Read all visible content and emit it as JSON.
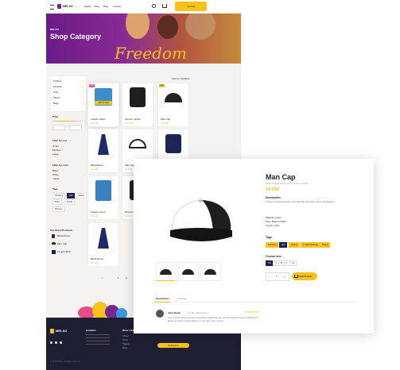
{
  "nav": {
    "logo_text": "MELAO",
    "items": [
      "Home",
      "Pages",
      "Shop",
      "Blog",
      "Contact"
    ],
    "button_label": "Contact"
  },
  "hero": {
    "brand": "MELAO",
    "title": "Shop Category",
    "script_text": "Freedom"
  },
  "sidebar": {
    "categories": [
      {
        "label": "Clothes",
        "count": "9"
      },
      {
        "label": "Dresses",
        "count": "12"
      },
      {
        "label": "Hats",
        "count": "6"
      },
      {
        "label": "Shoes",
        "count": "7"
      },
      {
        "label": "Bags",
        "count": "4"
      }
    ],
    "price_heading": "Price",
    "filter_size_heading": "Filter by size",
    "sizes": [
      "Small",
      "Medium",
      "Large"
    ],
    "filter_color_heading": "Filter by color",
    "colors": [
      "Black",
      "White",
      "Yellow"
    ],
    "tags_heading": "Tags",
    "tags": [
      "Clothing",
      "Hat",
      "Jacket",
      "Shirt",
      "Dress",
      "Women"
    ],
    "top_rated_heading": "Top Rated Products",
    "top_rated": [
      "Black Dress",
      "Man Cap",
      "Couple Tshirt"
    ]
  },
  "sort_label": "Sort by: Updates",
  "products": [
    {
      "name": "Classic Jeans",
      "price": "15.00$",
      "badge": "Sale",
      "badge_color": "#e94a8a"
    },
    {
      "name": "Women Jacket",
      "price": "22.00$",
      "badge": "",
      "badge_color": ""
    },
    {
      "name": "Man Cap",
      "price": "15.00$",
      "badge": "New",
      "badge_color": "#f7c31b"
    },
    {
      "name": "Black Dress",
      "price": "25.00$",
      "badge": "",
      "badge_color": ""
    },
    {
      "name": "Man Cap",
      "price": "15.00$",
      "badge": "",
      "badge_color": ""
    },
    {
      "name": "Sweatshirt",
      "price": "19.00$",
      "badge": "",
      "badge_color": ""
    },
    {
      "name": "Classic Jeans",
      "price": "15.00$",
      "badge": "",
      "badge_color": ""
    },
    {
      "name": "Women Jacket",
      "price": "22.00$",
      "badge": "",
      "badge_color": ""
    },
    {
      "name": "Black Dress",
      "price": "25.00$",
      "badge": "",
      "badge_color": ""
    }
  ],
  "add_to_cart_small": "Add To Cart",
  "pagination": [
    "1",
    "2"
  ],
  "footer": {
    "logo_text": "MELAO",
    "contacts_heading": "Contacts",
    "links_heading": "More Links",
    "links": [
      "About",
      "Shop",
      "Pages",
      "Blog"
    ],
    "subscribe_label": "Subscribe",
    "copyright": "© 2018 Melao. All rights reserved"
  },
  "modal": {
    "title": "Man Cap",
    "meta": "Article: 001295 ★★★★★ (5 customer reviews)",
    "price": "15.00$",
    "description_heading": "Description",
    "description": "A hat is a great accessory. Sun and rain protection, style and elegance.",
    "details": [
      "Material: Cotton",
      "Color: Black & White",
      "Country: USA"
    ],
    "tags_heading": "Tags",
    "tags": [
      "Clothing",
      "Hat",
      "Jacket",
      "T-shirt Clothing",
      "Dress"
    ],
    "selected_tag_index": 1,
    "size_heading": "Choose size",
    "sizes": [
      "XS",
      "S",
      "M",
      "L",
      "XL"
    ],
    "selected_size_index": 0,
    "quantity": "1",
    "add_to_cart": "Add To Cart",
    "tabs": [
      "Description",
      "Reviews"
    ],
    "review": {
      "author": "John Rolan",
      "date": "24 Jan 2018 at 8pm",
      "text": "Lorem ipsum dolor sit amet, consectetur adipiscing elit, sed do eiusmod tempor incididunt ut labore et dolore magna aliqua. Ut enim ad minim veniam."
    }
  },
  "colors": {
    "accent": "#f7c31b",
    "navy": "#1d1f4e",
    "purple": "#7a2591"
  }
}
